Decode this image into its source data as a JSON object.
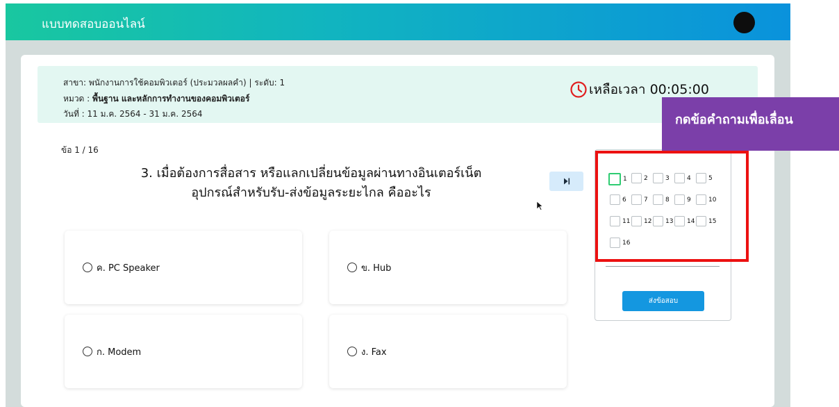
{
  "app": {
    "title": "แบบทดสอบออนไลน์"
  },
  "exam": {
    "branch": "สาขา: พนักงานการใช้คอมพิวเตอร์ (ประมวลผลคำ) | ระดับ: 1",
    "category_prefix": "หมวด : ",
    "category": "พื้นฐาน และหลักการทำงานของคอมพิวเตอร์",
    "date": "วันที่ : 11 ม.ค. 2564 - 31 ม.ค. 2564",
    "timer": "เหลือเวลา 00:05:00"
  },
  "question": {
    "counter": "ข้อ 1 / 16",
    "text_line1": "3. เมื่อต้องการสื่อสาร หรือแลกเปลี่ยนข้อมูลผ่านทางอินเตอร์เน็ต",
    "text_line2": "อุปกรณ์สำหรับรับ-ส่งข้อมูลระยะไกล คืออะไร",
    "options": [
      {
        "label": "ค. PC Speaker"
      },
      {
        "label": "ข. Hub"
      },
      {
        "label": "ก. Modem"
      },
      {
        "label": "ง. Fax"
      }
    ]
  },
  "nav": {
    "questions": [
      "1",
      "2",
      "3",
      "4",
      "5",
      "6",
      "7",
      "8",
      "9",
      "10",
      "11",
      "12",
      "13",
      "14",
      "15",
      "16"
    ],
    "active": 1,
    "submit_label": "ส่งข้อสอบ"
  },
  "tooltip": {
    "text": "กดข้อคำถามเพื่อเลื่อน"
  },
  "colors": {
    "accent": "#1497e0",
    "header_start": "#19c7a0",
    "header_end": "#0a92dc",
    "highlight": "#ec1111",
    "tooltip_bg": "#7b3fa9",
    "timer_icon": "#e02020"
  }
}
